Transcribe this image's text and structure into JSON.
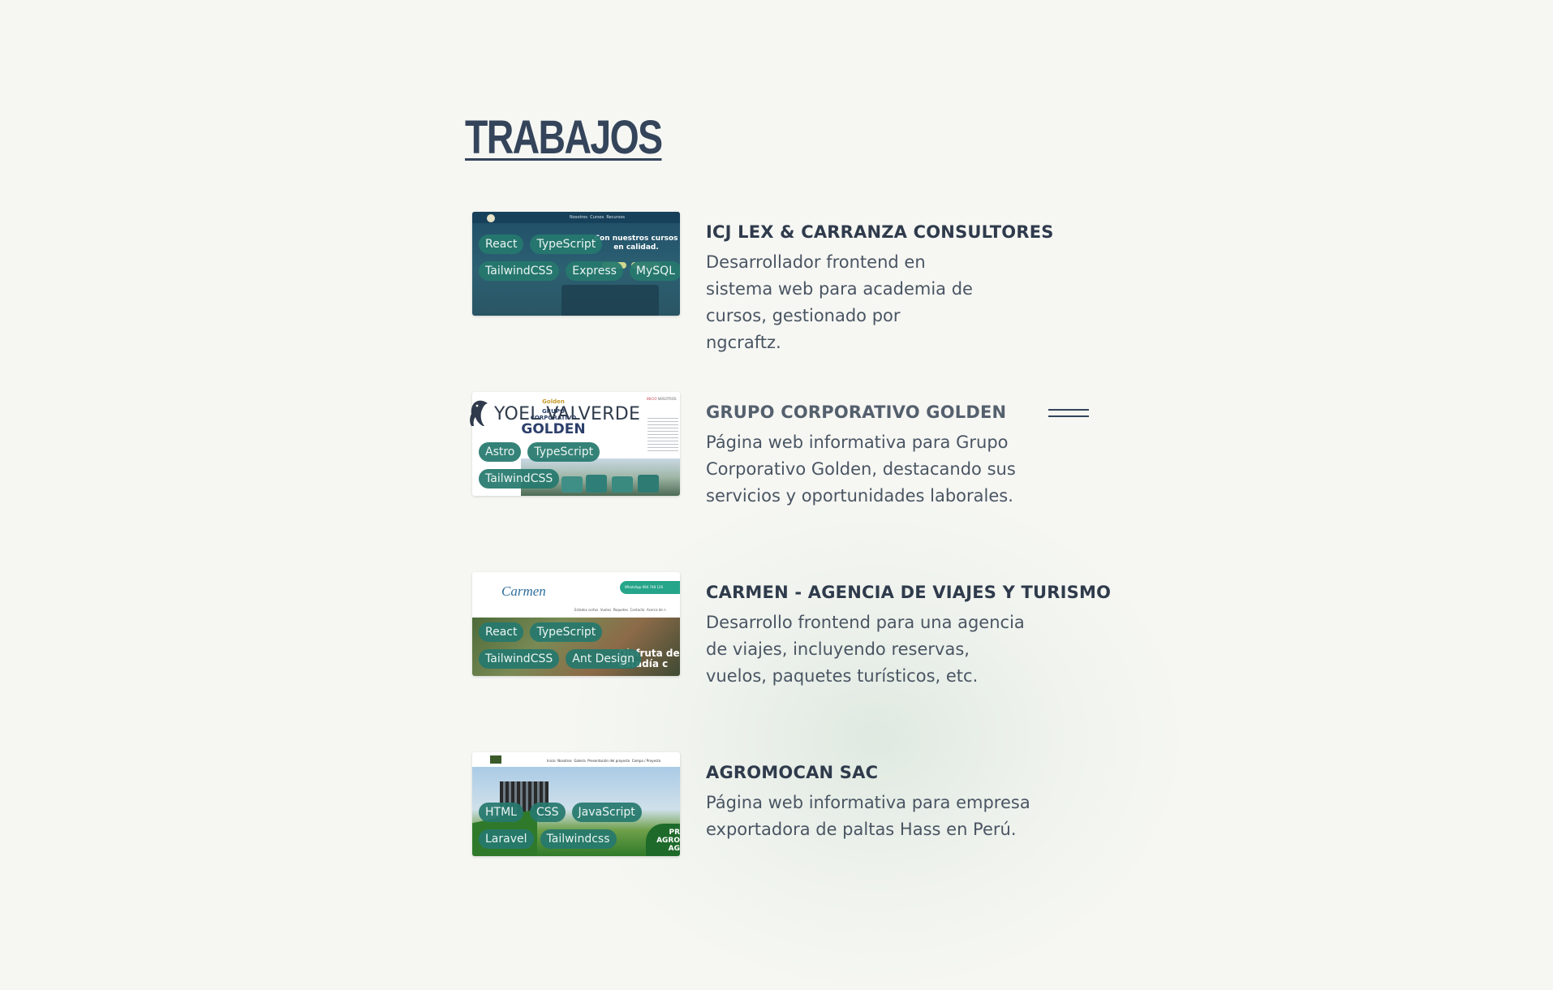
{
  "section_title": "TRABAJOS",
  "brand": {
    "name": "YOEL VALVERDE",
    "logo_icon": "penguin-icon"
  },
  "menu": {
    "icon": "menu-icon"
  },
  "colors": {
    "background": "#f6f7f3",
    "tag_bg": "#26786e",
    "title": "#34445a",
    "text": "#4a5563"
  },
  "projects": [
    {
      "title": "ICJ LEX & CARRANZA CONSULTORES",
      "description": "Desarrollador frontend en sistema web para academia de cursos, gestionado por ngcraftz.",
      "tags": [
        "React",
        "TypeScript",
        "TailwindCSS",
        "Express",
        "MySQL"
      ],
      "preview": {
        "headline": "Con nuestros cursos en calidad.",
        "nav": [
          "Nosotros",
          "Cursos",
          "Recursos"
        ]
      }
    },
    {
      "title": "GRUPO CORPORATIVO GOLDEN",
      "description": "Página web informativa para Grupo Corporativo Golden, destacando sus servicios y oportunidades laborales.",
      "tags": [
        "Astro",
        "TypeScript",
        "TailwindCSS"
      ],
      "preview": {
        "brand_top": "Golden",
        "brand_sub": "GRUPO CORPORATIVO",
        "brand_main": "GOLDEN",
        "nav": [
          "INICIO",
          "NOSOTROS"
        ]
      }
    },
    {
      "title": "CARMEN - AGENCIA DE VIAJES Y TURISMO",
      "description": "Desarrollo frontend para una agencia de viajes, incluyendo reservas, vuelos, paquetes turísticos, etc.",
      "tags": [
        "React",
        "TypeScript",
        "TailwindCSS",
        "Ant Design"
      ],
      "preview": {
        "brand": "Carmen",
        "whatsapp": "WhatsApp 984 748 126",
        "nav": [
          "Estados cortos",
          "Vuelos",
          "Paquetes",
          "Contacto",
          "Acerca de n"
        ],
        "hero": "Disfruta de estadía c"
      }
    },
    {
      "title": "AGROMOCAN SAC",
      "description": "Página web informativa para empresa exportadora de paltas Hass en Perú.",
      "tags": [
        "HTML",
        "CSS",
        "JavaScript",
        "Laravel",
        "Tailwindcss"
      ],
      "preview": {
        "nav": [
          "Inicio",
          "Nosotros",
          "Galería",
          "Presentación del proyecto",
          "Campo / Proyecto"
        ],
        "hero": "PR AGRO AG"
      }
    }
  ]
}
